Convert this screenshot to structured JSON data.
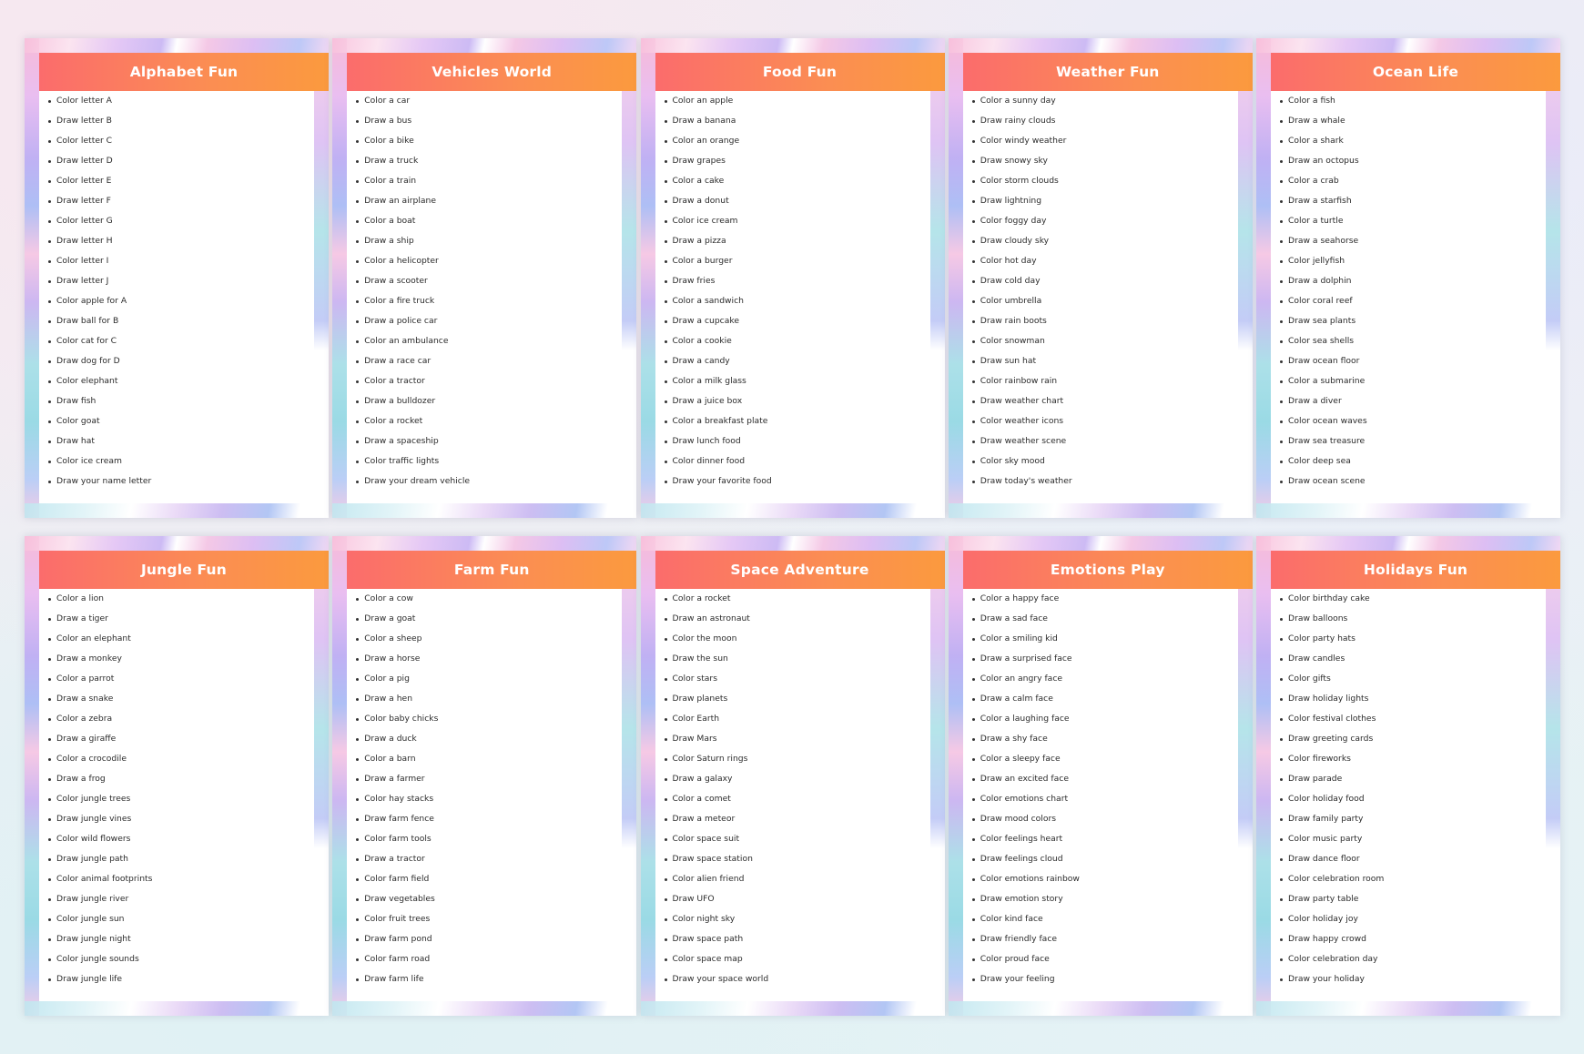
{
  "pages": [
    {
      "title": "Alphabet Fun",
      "items": [
        "Color letter A",
        "Draw letter B",
        "Color letter C",
        "Draw letter D",
        "Color letter E",
        "Draw letter F",
        "Color letter G",
        "Draw letter H",
        "Color letter I",
        "Draw letter J",
        "Color apple for A",
        "Draw ball for B",
        "Color cat for C",
        "Draw dog for D",
        "Color elephant",
        "Draw fish",
        "Color goat",
        "Draw hat",
        "Color ice cream",
        "Draw your name letter"
      ]
    },
    {
      "title": "Vehicles World",
      "items": [
        "Color a car",
        "Draw a bus",
        "Color a bike",
        "Draw a truck",
        "Color a train",
        "Draw an airplane",
        "Color a boat",
        "Draw a ship",
        "Color a helicopter",
        "Draw a scooter",
        "Color a fire truck",
        "Draw a police car",
        "Color an ambulance",
        "Draw a race car",
        "Color a tractor",
        "Draw a bulldozer",
        "Color a rocket",
        "Draw a spaceship",
        "Color traffic lights",
        "Draw your dream vehicle"
      ]
    },
    {
      "title": "Food Fun",
      "items": [
        "Color an apple",
        "Draw a banana",
        "Color an orange",
        "Draw grapes",
        "Color a cake",
        "Draw a donut",
        "Color ice cream",
        "Draw a pizza",
        "Color a burger",
        "Draw fries",
        "Color a sandwich",
        "Draw a cupcake",
        "Color a cookie",
        "Draw a candy",
        "Color a milk glass",
        "Draw a juice box",
        "Color a breakfast plate",
        "Draw lunch food",
        "Color dinner food",
        "Draw your favorite food"
      ]
    },
    {
      "title": "Weather Fun",
      "items": [
        "Color a sunny day",
        "Draw rainy clouds",
        "Color windy weather",
        "Draw snowy sky",
        "Color storm clouds",
        "Draw lightning",
        "Color foggy day",
        "Draw cloudy sky",
        "Color hot day",
        "Draw cold day",
        "Color umbrella",
        "Draw rain boots",
        "Color snowman",
        "Draw sun hat",
        "Color rainbow rain",
        "Draw weather chart",
        "Color weather icons",
        "Draw weather scene",
        "Color sky mood",
        "Draw today's weather"
      ]
    },
    {
      "title": "Ocean Life",
      "items": [
        "Color a fish",
        "Draw a whale",
        "Color a shark",
        "Draw an octopus",
        "Color a crab",
        "Draw a starfish",
        "Color a turtle",
        "Draw a seahorse",
        "Color jellyfish",
        "Draw a dolphin",
        "Color coral reef",
        "Draw sea plants",
        "Color sea shells",
        "Draw ocean floor",
        "Color a submarine",
        "Draw a diver",
        "Color ocean waves",
        "Draw sea treasure",
        "Color deep sea",
        "Draw ocean scene"
      ]
    },
    {
      "title": "Jungle Fun",
      "items": [
        "Color a lion",
        "Draw a tiger",
        "Color an elephant",
        "Draw a monkey",
        "Color a parrot",
        "Draw a snake",
        "Color a zebra",
        "Draw a giraffe",
        "Color a crocodile",
        "Draw a frog",
        "Color jungle trees",
        "Draw jungle vines",
        "Color wild flowers",
        "Draw jungle path",
        "Color animal footprints",
        "Draw jungle river",
        "Color jungle sun",
        "Draw jungle night",
        "Color jungle sounds",
        "Draw jungle life"
      ]
    },
    {
      "title": "Farm Fun",
      "items": [
        "Color a cow",
        "Draw a goat",
        "Color a sheep",
        "Draw a horse",
        "Color a pig",
        "Draw a hen",
        "Color baby chicks",
        "Draw a duck",
        "Color a barn",
        "Draw a farmer",
        "Color hay stacks",
        "Draw farm fence",
        "Color farm tools",
        "Draw a tractor",
        "Color farm field",
        "Draw vegetables",
        "Color fruit trees",
        "Draw farm pond",
        "Color farm road",
        "Draw farm life"
      ]
    },
    {
      "title": "Space Adventure",
      "items": [
        "Color a rocket",
        "Draw an astronaut",
        "Color the moon",
        "Draw the sun",
        "Color stars",
        "Draw planets",
        "Color Earth",
        "Draw Mars",
        "Color Saturn rings",
        "Draw a galaxy",
        "Color a comet",
        "Draw a meteor",
        "Color space suit",
        "Draw space station",
        "Color alien friend",
        "Draw UFO",
        "Color night sky",
        "Draw space path",
        "Color space map",
        "Draw your space world"
      ]
    },
    {
      "title": "Emotions Play",
      "items": [
        "Color a happy face",
        "Draw a sad face",
        "Color a smiling kid",
        "Draw a surprised face",
        "Color an angry face",
        "Draw a calm face",
        "Color a laughing face",
        "Draw a shy face",
        "Color a sleepy face",
        "Draw an excited face",
        "Color emotions chart",
        "Draw mood colors",
        "Color feelings heart",
        "Draw feelings cloud",
        "Color emotions rainbow",
        "Draw emotion story",
        "Color kind face",
        "Draw friendly face",
        "Color proud face",
        "Draw your feeling"
      ]
    },
    {
      "title": "Holidays Fun",
      "items": [
        "Color birthday cake",
        "Draw balloons",
        "Color party hats",
        "Draw candles",
        "Color gifts",
        "Draw holiday lights",
        "Color festival clothes",
        "Draw greeting cards",
        "Color fireworks",
        "Draw parade",
        "Color holiday food",
        "Draw family party",
        "Color music party",
        "Draw dance floor",
        "Color celebration room",
        "Draw party table",
        "Color holiday joy",
        "Draw happy crowd",
        "Color celebration day",
        "Draw your holiday"
      ]
    }
  ],
  "colors": {
    "header_start": "#fb6c6c",
    "header_end": "#fb9a3e",
    "header_text": "#ffffff",
    "item_text": "#2b2b2b"
  }
}
